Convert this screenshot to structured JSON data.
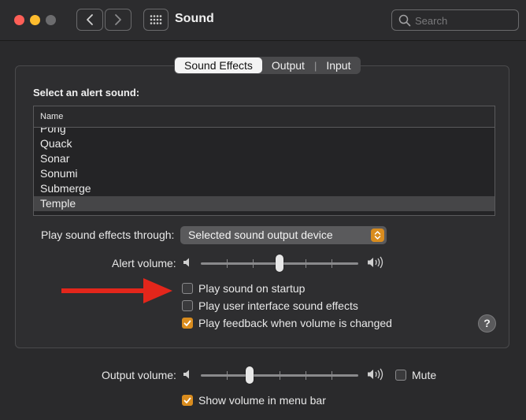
{
  "window": {
    "title": "Sound",
    "search_placeholder": "Search"
  },
  "tabs": [
    {
      "label": "Sound Effects",
      "active": true
    },
    {
      "label": "Output",
      "active": false
    },
    {
      "label": "Input",
      "active": false
    }
  ],
  "tab_separator": "|",
  "alert_section": {
    "heading": "Select an alert sound:",
    "column_header": "Name",
    "items": [
      "Pong",
      "Quack",
      "Sonar",
      "Sonumi",
      "Submerge",
      "Temple"
    ],
    "selected": "Temple"
  },
  "play_through": {
    "label": "Play sound effects through:",
    "value": "Selected sound output device"
  },
  "alert_volume": {
    "label": "Alert volume:",
    "level": 0.5
  },
  "checkboxes": {
    "startup": {
      "label": "Play sound on startup",
      "checked": false
    },
    "ui_effects": {
      "label": "Play user interface sound effects",
      "checked": false
    },
    "feedback": {
      "label": "Play feedback when volume is changed",
      "checked": true
    }
  },
  "help_label": "?",
  "output_volume": {
    "label": "Output volume:",
    "level": 0.3,
    "mute_label": "Mute",
    "mute_checked": false
  },
  "menu_bar": {
    "label": "Show volume in menu bar",
    "checked": true
  },
  "colors": {
    "accent": "#d98c1e",
    "arrow": "#e3261b",
    "close": "#fe5f57",
    "minimize": "#febc2e"
  },
  "icons": [
    "back-chevron-icon",
    "forward-chevron-icon",
    "grid-icon",
    "search-icon",
    "speaker-low-icon",
    "speaker-high-icon",
    "up-down-arrows-icon",
    "checkmark-icon"
  ]
}
